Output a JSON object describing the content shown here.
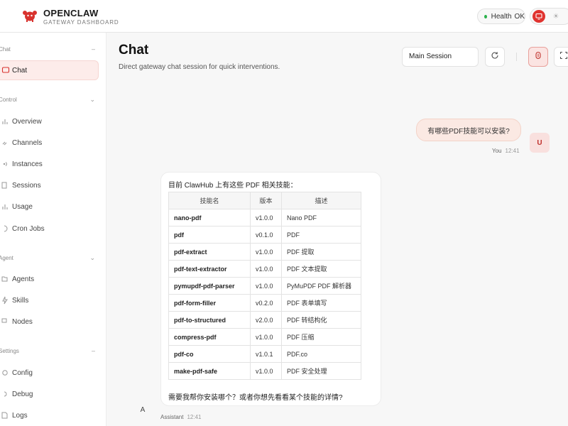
{
  "brand": {
    "title": "OPENCLAW",
    "subtitle": "GATEWAY DASHBOARD"
  },
  "health": {
    "label": "Health",
    "status": "OK",
    "color": "#2bb24c"
  },
  "colors": {
    "accent": "#e0332f"
  },
  "sidebar": {
    "groups": [
      {
        "label": "Chat",
        "items": [
          {
            "label": "Chat",
            "icon": "chat-bubble-icon",
            "active": true
          }
        ]
      },
      {
        "label": "Control",
        "items": [
          {
            "label": "Overview",
            "icon": "bar-chart-icon"
          },
          {
            "label": "Channels",
            "icon": "link-icon"
          },
          {
            "label": "Instances",
            "icon": "radio-icon"
          },
          {
            "label": "Sessions",
            "icon": "document-icon"
          },
          {
            "label": "Usage",
            "icon": "bar-chart-icon"
          },
          {
            "label": "Cron Jobs",
            "icon": "clock-icon"
          }
        ]
      },
      {
        "label": "Agent",
        "items": [
          {
            "label": "Agents",
            "icon": "folder-icon"
          },
          {
            "label": "Skills",
            "icon": "bolt-icon"
          },
          {
            "label": "Nodes",
            "icon": "monitor-icon"
          }
        ]
      },
      {
        "label": "Settings",
        "items": [
          {
            "label": "Config",
            "icon": "gear-icon"
          },
          {
            "label": "Debug",
            "icon": "bug-icon"
          },
          {
            "label": "Logs",
            "icon": "file-icon"
          }
        ]
      }
    ]
  },
  "page": {
    "title": "Chat",
    "subtitle": "Direct gateway chat session for quick interventions.",
    "session": "Main Session"
  },
  "messages": {
    "user": {
      "text": "有哪些PDF技能可以安装?",
      "sender": "You",
      "time": "12:41",
      "avatar": "U"
    },
    "assistant": {
      "intro": "目前 ClawHub 上有这些 PDF 相关技能：",
      "table": {
        "headers": [
          "技能名",
          "版本",
          "描述"
        ],
        "rows": [
          [
            "nano-pdf",
            "v1.0.0",
            "Nano PDF"
          ],
          [
            "pdf",
            "v0.1.0",
            "PDF"
          ],
          [
            "pdf-extract",
            "v1.0.0",
            "PDF 提取"
          ],
          [
            "pdf-text-extractor",
            "v1.0.0",
            "PDF 文本提取"
          ],
          [
            "pymupdf-pdf-parser",
            "v1.0.0",
            "PyMuPDF PDF 解析器"
          ],
          [
            "pdf-form-filler",
            "v0.2.0",
            "PDF 表单填写"
          ],
          [
            "pdf-to-structured",
            "v2.0.0",
            "PDF 转结构化"
          ],
          [
            "compress-pdf",
            "v1.0.0",
            "PDF 压缩"
          ],
          [
            "pdf-co",
            "v1.0.1",
            "PDF.co"
          ],
          [
            "make-pdf-safe",
            "v1.0.0",
            "PDF 安全处理"
          ]
        ]
      },
      "outro": "需要我帮你安装哪个？或者你想先看看某个技能的详情?",
      "sender": "Assistant",
      "time": "12:41",
      "avatar": "A"
    }
  }
}
